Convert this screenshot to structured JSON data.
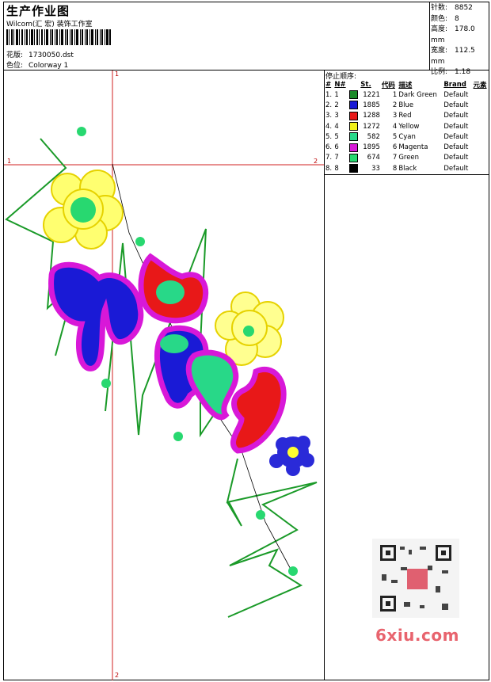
{
  "header": {
    "title": "生产作业图",
    "studio": "Wilcom(汇 宏) 装饰工作室",
    "design_label": "花版:",
    "design_value": "1730050.dst",
    "colorway_label": "色位:",
    "colorway_value": "Colorway 1"
  },
  "stats": {
    "stitches_label": "针数:",
    "stitches_value": "8852",
    "colors_label": "颜色:",
    "colors_value": "8",
    "height_label": "高度:",
    "height_value": "178.0 mm",
    "width_label": "宽度:",
    "width_value": "112.5 mm",
    "scale_label": "比例:",
    "scale_value": "1.18"
  },
  "stop_sequence": {
    "title": "停止顺序:",
    "headers": [
      "#",
      "N#",
      "St.",
      "代码",
      "描述",
      "Brand",
      "元素"
    ],
    "rows": [
      {
        "idx": "1.",
        "n": "1",
        "color": "#1a8a28",
        "st": "1221",
        "code": "1",
        "desc": "Dark Green",
        "brand": "Default"
      },
      {
        "idx": "2.",
        "n": "2",
        "color": "#1a1ad6",
        "st": "1885",
        "code": "2",
        "desc": "Blue",
        "brand": "Default"
      },
      {
        "idx": "3.",
        "n": "3",
        "color": "#e81818",
        "st": "1288",
        "code": "3",
        "desc": "Red",
        "brand": "Default"
      },
      {
        "idx": "4.",
        "n": "4",
        "color": "#f0f018",
        "st": "1272",
        "code": "4",
        "desc": "Yellow",
        "brand": "Default"
      },
      {
        "idx": "5.",
        "n": "5",
        "color": "#28d88a",
        "st": "582",
        "code": "5",
        "desc": "Cyan",
        "brand": "Default"
      },
      {
        "idx": "6.",
        "n": "6",
        "color": "#d818d8",
        "st": "1895",
        "code": "6",
        "desc": "Magenta",
        "brand": "Default"
      },
      {
        "idx": "7.",
        "n": "7",
        "color": "#28d870",
        "st": "674",
        "code": "7",
        "desc": "Green",
        "brand": "Default"
      },
      {
        "idx": "8.",
        "n": "8",
        "color": "#000000",
        "st": "33",
        "code": "8",
        "desc": "Black",
        "brand": "Default"
      }
    ]
  },
  "axes": {
    "h_left": "1",
    "h_right": "2",
    "v_top": "1",
    "v_bottom": "2"
  },
  "watermark": "6xiu.com",
  "colors": {
    "guide": "#d02020",
    "border": "#000000"
  }
}
